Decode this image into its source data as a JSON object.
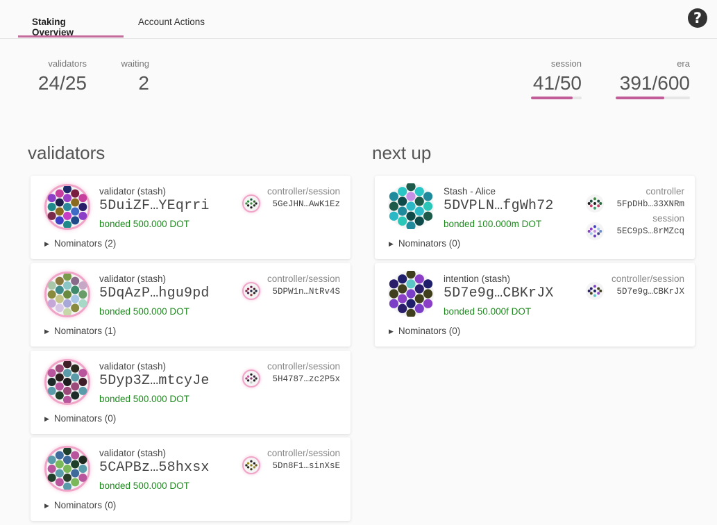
{
  "tabs": [
    {
      "label": "Staking Overview",
      "active": true
    },
    {
      "label": "Account Actions",
      "active": false
    }
  ],
  "summary": {
    "validators": {
      "label": "validators",
      "value": "24/25"
    },
    "waiting": {
      "label": "waiting",
      "value": "2"
    },
    "session": {
      "label": "session",
      "value": "41/50",
      "progress": 0.82
    },
    "era": {
      "label": "era",
      "value": "391/600",
      "progress": 0.65
    }
  },
  "validators_section": {
    "title": "validators",
    "cards": [
      {
        "role": "validator (stash)",
        "address": "5DuiZF…YEqrri",
        "bonded": "bonded 500.000 DOT",
        "nominators": "Nominators (2)",
        "controller_label": "controller/session",
        "controller_address": "5GeJHN…AwK1Ez",
        "colors": [
          "#8b3fc6",
          "#1e8a8a",
          "#7a2a4a",
          "#c63f9c",
          "#1e1e4a",
          "#8a6a1e",
          "#3f3fc6",
          "#1e2a6a",
          "#9c3fc6",
          "#2a8a9c",
          "#c63fc6",
          "#1e8a8a",
          "#7a1e3f",
          "#8a6a1e",
          "#3f6ac6",
          "#1e4a8a",
          "#c63f9c",
          "#2a1e6a",
          "#8b3fc6"
        ],
        "mini_colors": [
          "#2a8a3f",
          "#1e1e1e",
          "#1e5a3f",
          "#3f8a3f",
          "#1e1e1e",
          "#2a6a2a",
          "#1e3f1e",
          "#4a8a4a",
          "#1e1e1e"
        ]
      },
      {
        "role": "validator (stash)",
        "address": "5DqAzP…hgu9pd",
        "bonded": "bonded 500.000 DOT",
        "nominators": "Nominators (1)",
        "controller_label": "controller/session",
        "controller_address": "5DPW1n…NtRv4S",
        "colors": [
          "#a8c6a8",
          "#8a8a3f",
          "#c6a8d8",
          "#8a7a3f",
          "#3f8a8a",
          "#c6c68a",
          "#d8c6e6",
          "#7a9c4a",
          "#8ac6c6",
          "#6a8a3f",
          "#a8a8d8",
          "#c6d8a8",
          "#8a6a8a",
          "#3f8a6a",
          "#a8c6e6",
          "#8a8a3f",
          "#c6a8c6",
          "#6a9c6a",
          "#a8d8c6"
        ],
        "mini_colors": [
          "#8a1e3f",
          "#3f1e3f",
          "#6a1e4a",
          "#1e1e3f",
          "#8a3f3f",
          "#4a1e2a",
          "#2a1e1e",
          "#7a2a4a",
          "#1e2a3f"
        ]
      },
      {
        "role": "validator (stash)",
        "address": "5Dyp3Z…mtcyJe",
        "bonded": "bonded 500.000 DOT",
        "nominators": "Nominators (0)",
        "controller_label": "controller/session",
        "controller_address": "5H4787…zc2P5x",
        "colors": [
          "#b8559c",
          "#1e2a2a",
          "#5a9caa",
          "#9c4a7a",
          "#2a1e1e",
          "#b8559c",
          "#1e3f2a",
          "#3f1e2a",
          "#5a9caa",
          "#1e1e1e",
          "#9c4a7a",
          "#b8559c",
          "#2a2a1e",
          "#5a9caa",
          "#9c4a7a",
          "#1e2a2a",
          "#b8559c",
          "#3f1e2a",
          "#5a9caa"
        ],
        "mini_colors": [
          "#c6559c",
          "#2a1e2a",
          "#1e1e1e",
          "#8a3f6a",
          "#c6c6c6",
          "#3f1e3f",
          "#1e1e1e",
          "#9c4a7a",
          "#2a2a2a"
        ]
      },
      {
        "role": "validator (stash)",
        "address": "5CAPBz…58hxsx",
        "bonded": "bonded 500.000 DOT",
        "nominators": "Nominators (0)",
        "controller_label": "controller/session",
        "controller_address": "5Dn8F1…sinXsE",
        "colors": [
          "#5a9caa",
          "#b8559c",
          "#1e3f2a",
          "#3f6a9c",
          "#7ab85a",
          "#5a9caa",
          "#b8559c",
          "#1e3f2a",
          "#3f6a9c",
          "#7ab85a",
          "#2a3f2a",
          "#5a9caa",
          "#b8559c",
          "#1e3f2a",
          "#3f6a9c",
          "#7ab85a",
          "#1e2a1e",
          "#5a9caa",
          "#b8559c"
        ],
        "mini_colors": [
          "#9c8a1e",
          "#2a2a1e",
          "#1e1e1e",
          "#8a7a1e",
          "#3f3f1e",
          "#1e1e1e",
          "#9c8a1e",
          "#2a2a1e",
          "#6a5a1e"
        ]
      }
    ]
  },
  "next_up_section": {
    "title": "next up",
    "cards": [
      {
        "role": "Stash - Alice",
        "address": "5DVPLN…fgWh72",
        "bonded": "bonded 100.000m DOT",
        "nominators": "Nominators (0)",
        "controller_label": "controller",
        "controller_address": "5FpDHb…33XNRm",
        "session_label": "session",
        "session_address": "5EC9pS…8rMZcq",
        "colors": [
          "#1e8a9c",
          "#1e5a4a",
          "#2ab8c6",
          "#2ac6c6",
          "#0e4a4a",
          "#1e8a9c",
          "#2ac6b8",
          "#1e5a4a",
          "#c690e6",
          "#2ab8c6",
          "#0e4a4a",
          "#1e8a9c",
          "#2ac6c6",
          "#1e5a4a",
          "#2ab8c6",
          "#0e4a4a",
          "#1e8a9c",
          "#2ac6b8",
          "#1e5a4a"
        ],
        "mini_colors": [
          "#1e4a3f",
          "#c63f6a",
          "#3f8a3f",
          "#1e1e1e",
          "#3f9c6a",
          "#1e4a3f",
          "#c63f6a",
          "#1e1e1e",
          "#2a6a3f"
        ],
        "mini2_colors": [
          "#8a3fc6",
          "#a8c6e6",
          "#3f3fc6",
          "#c690e6",
          "#6a3fc6",
          "#a8c6e6",
          "#3f3f8a",
          "#8a3fc6",
          "#6a8ac6"
        ]
      },
      {
        "role": "intention (stash)",
        "address": "5D7e9g…CBKrJX",
        "bonded": "bonded 50.000f DOT",
        "nominators": "Nominators (0)",
        "controller_label": "controller/session",
        "controller_address": "5D7e9g…CBKrJX",
        "colors": [
          "#2a1e6a",
          "#3f3f1e",
          "#7a3fc6",
          "#1e1e6a",
          "#3f3f1e",
          "#8a3fc6",
          "#2a1e6a",
          "#3f3f1e",
          "#5ac6c6",
          "#7a3fc6",
          "#1e1e6a",
          "#3f3f1e",
          "#8a3fc6",
          "#2a1e6a",
          "#3f3f1e",
          "#7a3fc6",
          "#1e1e6a",
          "#3f3f1e",
          "#8a3fc6"
        ],
        "mini_colors": [
          "#2a1e6a",
          "#3f3f1e",
          "#7a3fc6",
          "#1e1e6a",
          "#5ac6c6",
          "#3f3f1e",
          "#8a3fc6",
          "#2a1e6a",
          "#3f3f1e"
        ]
      }
    ]
  }
}
